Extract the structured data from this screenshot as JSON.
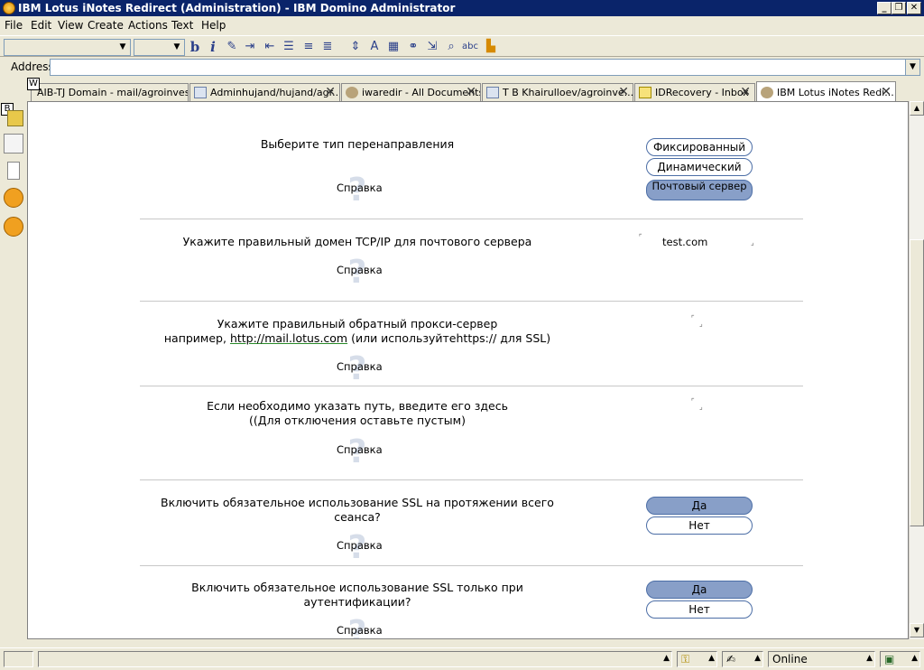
{
  "window": {
    "title": "IBM Lotus iNotes Redirect (Administration) - IBM Domino Administrator",
    "minimize": "_",
    "maximize": "❐",
    "close": "✕"
  },
  "menu": {
    "file": "File",
    "edit": "Edit",
    "view": "View",
    "create": "Create",
    "actions": "Actions",
    "text": "Text",
    "help": "Help"
  },
  "toolbar": {
    "bold": "b",
    "italic": "i"
  },
  "address": {
    "label": "Address",
    "value": ""
  },
  "tabs": [
    {
      "label": "AIB-TJ Domain - mail/agroinvest...",
      "close": "✕"
    },
    {
      "label": "Adminhujand/hujand/agr...",
      "close": "✕"
    },
    {
      "label": "iwaredir - All Documents",
      "close": "✕"
    },
    {
      "label": "T B Khairulloev/agroinve...",
      "close": "✕"
    },
    {
      "label": "IDRecovery - Inbox",
      "close": "✕"
    },
    {
      "label": "IBM Lotus iNotes Redi...",
      "close": "✕"
    }
  ],
  "badges": {
    "w": "W",
    "b": "B"
  },
  "form": {
    "help_label": "Справка",
    "help_mark": "?",
    "redirect_type": {
      "question": "Выберите тип перенаправления",
      "options": [
        "Фиксированный",
        "Динамический",
        "Почтовый сервер"
      ],
      "selected": "Почтовый сервер"
    },
    "tcp_domain": {
      "question": "Укажите правильный домен TCP/IP для почтового сервера",
      "value": "test.com"
    },
    "reverse_proxy": {
      "question_line1": "Укажите правильный обратный прокси-сервер",
      "question_prefix": "например, ",
      "question_link": "http://mail.lotus.com",
      "question_suffix": " (или используйтеhttps:// для SSL)",
      "value": ""
    },
    "path": {
      "question_line1": "Если необходимо указать путь, введите его здесь",
      "question_line2": "((Для отключения оставьте пустым)",
      "value": ""
    },
    "ssl_session": {
      "question_line1": "Включить обязательное использование SSL на протяжении всего",
      "question_line2": "сеанса?",
      "yes": "Да",
      "no": "Нет",
      "selected": "Да"
    },
    "ssl_auth": {
      "question_line1": "Включить обязательное использование SSL только при",
      "question_line2": "аутентификации?",
      "yes": "Да",
      "no": "Нет",
      "selected": "Да"
    }
  },
  "statusbar": {
    "online": "Online"
  }
}
